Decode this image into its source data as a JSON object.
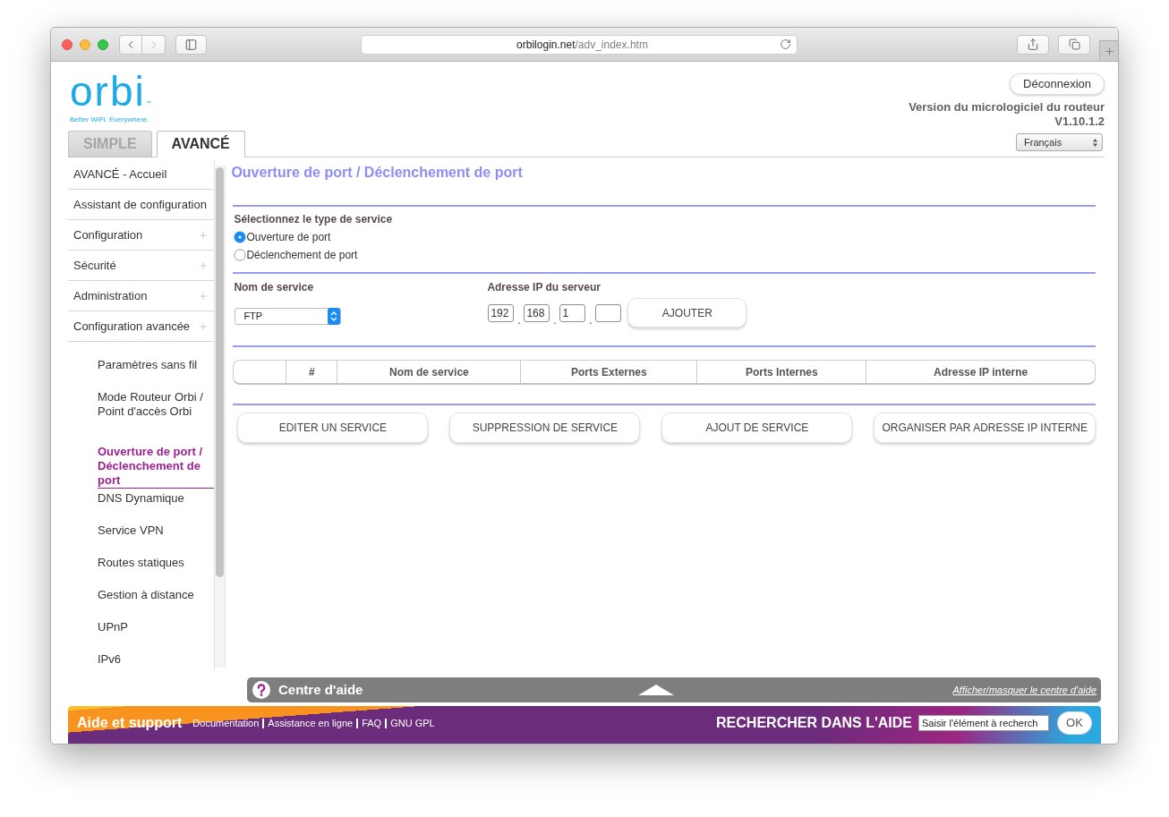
{
  "browser": {
    "back_button": {
      "disabled": false
    },
    "forward_button": {
      "disabled": true
    },
    "address": {
      "host": "orbilogin.net",
      "path": "/adv_index.htm"
    }
  },
  "header": {
    "logo": {
      "wordmark": "orbi",
      "trademark": "™",
      "tagline": "Better WiFi. Everywhere."
    },
    "logout_button": "Déconnexion",
    "firmware": {
      "label": "Version du micrologiciel du routeur",
      "version": "V1.10.1.2"
    },
    "language": "Français"
  },
  "tabs": [
    {
      "label": "SIMPLE",
      "selected": false
    },
    {
      "label": "AVANCÉ",
      "selected": true
    }
  ],
  "sidebar": {
    "items": [
      {
        "label": "AVANCÉ - Accueil",
        "kind": "link",
        "selected": false
      },
      {
        "label": "Assistant de configuration",
        "kind": "link",
        "selected": false
      },
      {
        "label": "Configuration",
        "kind": "section",
        "selected": false
      },
      {
        "label": "Sécurité",
        "kind": "section",
        "selected": false
      },
      {
        "label": "Administration",
        "kind": "section",
        "selected": false
      },
      {
        "label": "Configuration avancée",
        "kind": "section",
        "selected": false,
        "children": [
          {
            "label": "Paramètres sans fil",
            "selected": false
          },
          {
            "label": "Mode Routeur Orbi / Point d'accès Orbi",
            "selected": false
          },
          {
            "label": "Ouverture de port / Déclenchement de port",
            "selected": true
          },
          {
            "label": "DNS Dynamique",
            "selected": false
          },
          {
            "label": "Service VPN",
            "selected": false
          },
          {
            "label": "Routes statiques",
            "selected": false
          },
          {
            "label": "Gestion à distance",
            "selected": false
          },
          {
            "label": "UPnP",
            "selected": false
          },
          {
            "label": "IPv6",
            "selected": false
          }
        ]
      }
    ]
  },
  "page": {
    "title": "Ouverture de port / Déclenchement de port",
    "service_type": {
      "label": "Sélectionnez le type de service",
      "options": [
        {
          "label": "Ouverture de port",
          "selected": true
        },
        {
          "label": "Déclenchement de port",
          "selected": false
        }
      ]
    },
    "service_name": {
      "label": "Nom de service",
      "value": "FTP"
    },
    "server_ip": {
      "label": "Adresse IP du serveur",
      "octets": [
        "192",
        "168",
        "1"
      ],
      "separators": [
        ".",
        ".",
        "."
      ],
      "button": "AJOUTER"
    },
    "table": {
      "columns": [
        "#",
        "Nom de service",
        "Ports Externes",
        "Ports Internes",
        "Adresse IP interne"
      ]
    },
    "actions": [
      "EDITER UN SERVICE",
      "SUPPRESSION DE SERVICE",
      "AJOUT DE SERVICE",
      "ORGANISER PAR ADRESSE IP INTERNE"
    ]
  },
  "help_bar": {
    "title": "Centre d'aide",
    "toggle_link": "Afficher/masquer le centre d'aide"
  },
  "footer": {
    "title": "Aide et support",
    "links": [
      "Documentation",
      "Assistance en ligne",
      "FAQ",
      "GNU GPL"
    ],
    "search": {
      "label": "RECHERCHER DANS L'AIDE",
      "placeholder": "Saisir l'élément à recherch",
      "button": "OK"
    }
  }
}
